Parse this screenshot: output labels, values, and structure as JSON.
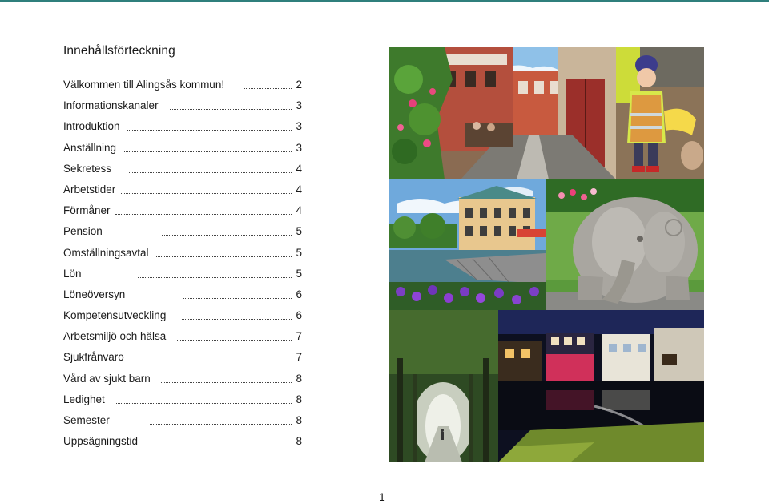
{
  "page": {
    "title": "Innehållsförteckning",
    "page_number": "1"
  },
  "toc": [
    {
      "label": "Välkommen till Alingsås kommun!",
      "page": "2",
      "dots_start": 225
    },
    {
      "label": "Informationskanaler",
      "page": "3",
      "dots_start": 133
    },
    {
      "label": "Introduktion",
      "page": "3",
      "dots_start": 80
    },
    {
      "label": "Anställning",
      "page": "3",
      "dots_start": 74
    },
    {
      "label": "Sekretess",
      "page": "4",
      "dots_start": 82
    },
    {
      "label": "Arbetstider",
      "page": "4",
      "dots_start": 72
    },
    {
      "label": "Förmåner",
      "page": "4",
      "dots_start": 65
    },
    {
      "label": "Pension",
      "page": "5",
      "dots_start": 123
    },
    {
      "label": "Omställningsavtal",
      "page": "5",
      "dots_start": 116
    },
    {
      "label": "Lön",
      "page": "5",
      "dots_start": 93
    },
    {
      "label": "Löneöversyn",
      "page": "6",
      "dots_start": 149
    },
    {
      "label": "Kompetensutveckling",
      "page": "6",
      "dots_start": 148
    },
    {
      "label": "Arbetsmiljö och hälsa",
      "page": "7",
      "dots_start": 142
    },
    {
      "label": "Sjukfrånvaro",
      "page": "7",
      "dots_start": 126
    },
    {
      "label": "Vård av sjukt barn",
      "page": "8",
      "dots_start": 122
    },
    {
      "label": "Ledighet",
      "page": "8",
      "dots_start": 66
    },
    {
      "label": "Semester",
      "page": "8",
      "dots_start": 108
    },
    {
      "label": "Uppsägningstid",
      "page": "8",
      "dots_start": null
    }
  ],
  "colors": {
    "accent_rule": "#2f7f7c"
  },
  "photos": [
    "photo-cafe-courtyard",
    "photo-child-sandbox",
    "photo-town-canal",
    "photo-elephant-sculpture",
    "photo-misty-alley",
    "photo-night-buildings"
  ]
}
